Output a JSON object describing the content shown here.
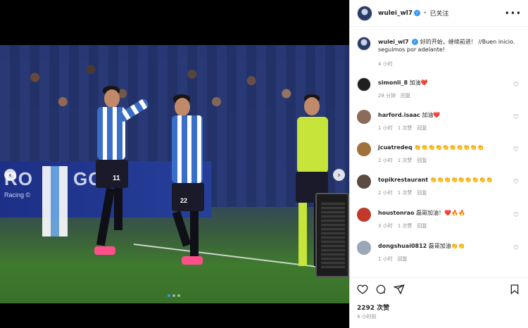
{
  "post": {
    "username": "wulei_wl7",
    "follow_status": "已关注",
    "separator": "•",
    "caption_user": "wulei_wl7",
    "caption_text": "好的开始，继续前进！ //Buen inicio. seguimos por adelante!",
    "caption_time": "4 小时",
    "likes_count": "2292 次赞",
    "time_ago": "4 小时前",
    "ad_text": "RO",
    "ad_sub": "Racing ©",
    "ad_text2": "GO",
    "jersey_left": "11",
    "jersey_right": "22"
  },
  "comments": [
    {
      "user": "simonli_8",
      "text": "加油❤️",
      "time": "28 分钟",
      "likes": "",
      "reply": "回复",
      "avatar_color": "#1f1f1f"
    },
    {
      "user": "harford.isaac",
      "text": "加油❤️",
      "time": "1 小时",
      "likes": "1 次赞",
      "reply": "回复",
      "avatar_color": "#8b6b5a"
    },
    {
      "user": "jcuatredeq",
      "text": "👏👏👏👏👏👏👏👏👏👏",
      "time": "2 小时",
      "likes": "1 次赞",
      "reply": "回复",
      "avatar_color": "#a0703d"
    },
    {
      "user": "topikrestaurant",
      "text": "👏👏👏👏👏👏👏👏👏",
      "time": "2 小时",
      "likes": "1 次赞",
      "reply": "回复",
      "avatar_color": "#5b4a40"
    },
    {
      "user": "houstonrao",
      "text": "磊哥加油！❤️🔥🔥",
      "time": "3 小时",
      "likes": "1 次赞",
      "reply": "回复",
      "avatar_color": "#c0392b"
    },
    {
      "user": "dongshuai0812",
      "text": "磊哥加油👏👏",
      "time": "1 小时",
      "likes": "",
      "reply": "回复",
      "avatar_color": "#9aa7b8"
    }
  ],
  "icons": {
    "more": "•••",
    "heart": "♡",
    "nav_prev": "‹",
    "nav_next": "›"
  }
}
